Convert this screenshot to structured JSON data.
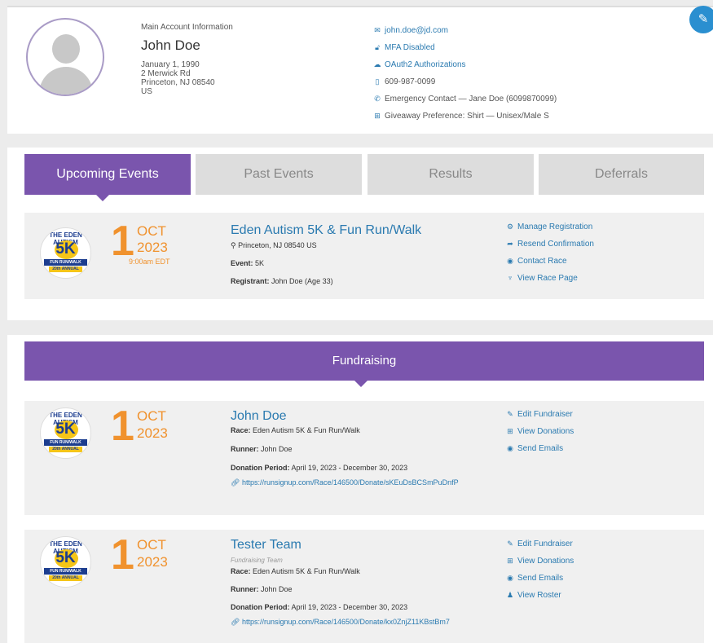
{
  "account": {
    "heading": "Main Account Information",
    "name": "John Doe",
    "dob": "January 1, 1990",
    "address1": "2 Merwick Rd",
    "address2": "Princeton, NJ 08540",
    "country": "US",
    "contact": {
      "email": "john.doe@jd.com",
      "mfa": "MFA Disabled",
      "oauth": "OAuth2 Authorizations",
      "phone": "609-987-0099",
      "emergency": "Emergency Contact — Jane Doe (6099870099)",
      "giveaway": "Giveaway Preference: Shirt — Unisex/Male S"
    }
  },
  "tabs": [
    "Upcoming Events",
    "Past Events",
    "Results",
    "Deferrals"
  ],
  "logo": {
    "line1": "THE EDEN AUTISM",
    "line2": "5K",
    "line3": "FUN RUN/WALK",
    "line4": "20th ANNUAL"
  },
  "upcoming": {
    "day": "1",
    "month": "OCT",
    "year": "2023",
    "time": "9:00am EDT",
    "title": "Eden Autism 5K & Fun Run/Walk",
    "location": "Princeton, NJ 08540 US",
    "event_label": "Event:",
    "event_value": "5K",
    "registrant_label": "Registrant:",
    "registrant_value": "John Doe (Age 33)",
    "actions": [
      "Manage Registration",
      "Resend Confirmation",
      "Contact Race",
      "View Race Page"
    ]
  },
  "fundraising": {
    "heading": "Fundraising",
    "items": [
      {
        "day": "1",
        "month": "OCT",
        "year": "2023",
        "title": "John Doe",
        "subtitle": "",
        "race_label": "Race:",
        "race_value": "Eden Autism 5K & Fun Run/Walk",
        "runner_label": "Runner:",
        "runner_value": "John Doe",
        "period_label": "Donation Period:",
        "period_value": "April 19, 2023 - December 30, 2023",
        "url": "https://runsignup.com/Race/146500/Donate/sKEuDsBCSmPuDnfP",
        "actions": [
          "Edit Fundraiser",
          "View Donations",
          "Send Emails"
        ]
      },
      {
        "day": "1",
        "month": "OCT",
        "year": "2023",
        "title": "Tester Team",
        "subtitle": "Fundraising Team",
        "race_label": "Race:",
        "race_value": "Eden Autism 5K & Fun Run/Walk",
        "runner_label": "Runner:",
        "runner_value": "John Doe",
        "period_label": "Donation Period:",
        "period_value": "April 19, 2023 - December 30, 2023",
        "url": "https://runsignup.com/Race/146500/Donate/kx0ZnjZ11KBstBm7",
        "actions": [
          "Edit Fundraiser",
          "View Donations",
          "Send Emails",
          "View Roster"
        ]
      }
    ]
  },
  "icons": {
    "accent": "#7a55ad",
    "link": "#2a7ab0",
    "date": "#f0922e"
  }
}
